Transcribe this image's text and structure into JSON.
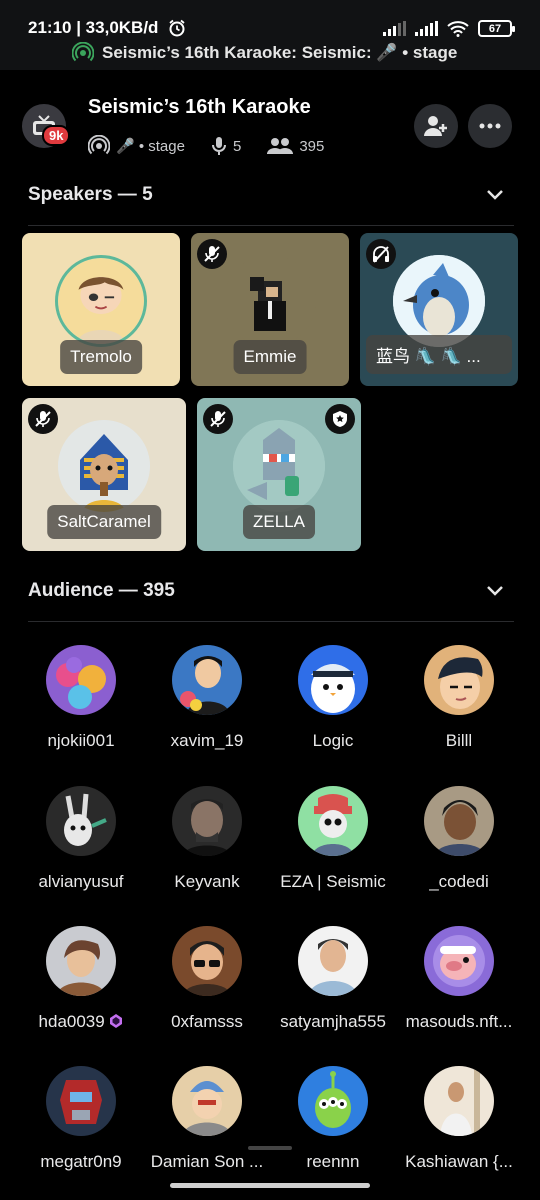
{
  "status_bar": {
    "time_speed": "21:10 | 33,0KB/d",
    "battery": "67",
    "stage_text": "Seismic’s 16th Karaoke: Seismic: 🎤 • stage"
  },
  "header": {
    "server_badge": "9k",
    "title": "Seismic’s 16th Karaoke",
    "stage_label": "🎤 • stage",
    "speaker_count": "5",
    "listener_count": "395"
  },
  "speakers_section": {
    "title": "Speakers — 5",
    "items": [
      {
        "name": "Tremolo",
        "bg": "#f1dfb3",
        "muted": false
      },
      {
        "name": "Emmie",
        "bg": "#807656",
        "muted": true
      },
      {
        "name": "蓝鸟 🛝 🛝 ...",
        "bg": "#2b4a55",
        "muted": true
      },
      {
        "name": "SaltCaramel",
        "bg": "#e7dfcc",
        "muted": true
      },
      {
        "name": "ZELLA",
        "bg": "#8fb8b3",
        "muted": true
      }
    ]
  },
  "audience_section": {
    "title": "Audience — 395",
    "items": [
      {
        "name": "njokii001"
      },
      {
        "name": "xavim_19"
      },
      {
        "name": "Logic"
      },
      {
        "name": "Billl"
      },
      {
        "name": "alvianyusuf"
      },
      {
        "name": "Keyvank"
      },
      {
        "name": "EZA | Seismic"
      },
      {
        "name": "_codedi"
      },
      {
        "name": "hda0039"
      },
      {
        "name": "0xfamsss"
      },
      {
        "name": "satyamjha555"
      },
      {
        "name": "masouds.nft..."
      },
      {
        "name": "megatr0n9"
      },
      {
        "name": "Damian Son ..."
      },
      {
        "name": "reennn"
      },
      {
        "name": "Kashiawan {..."
      }
    ]
  }
}
